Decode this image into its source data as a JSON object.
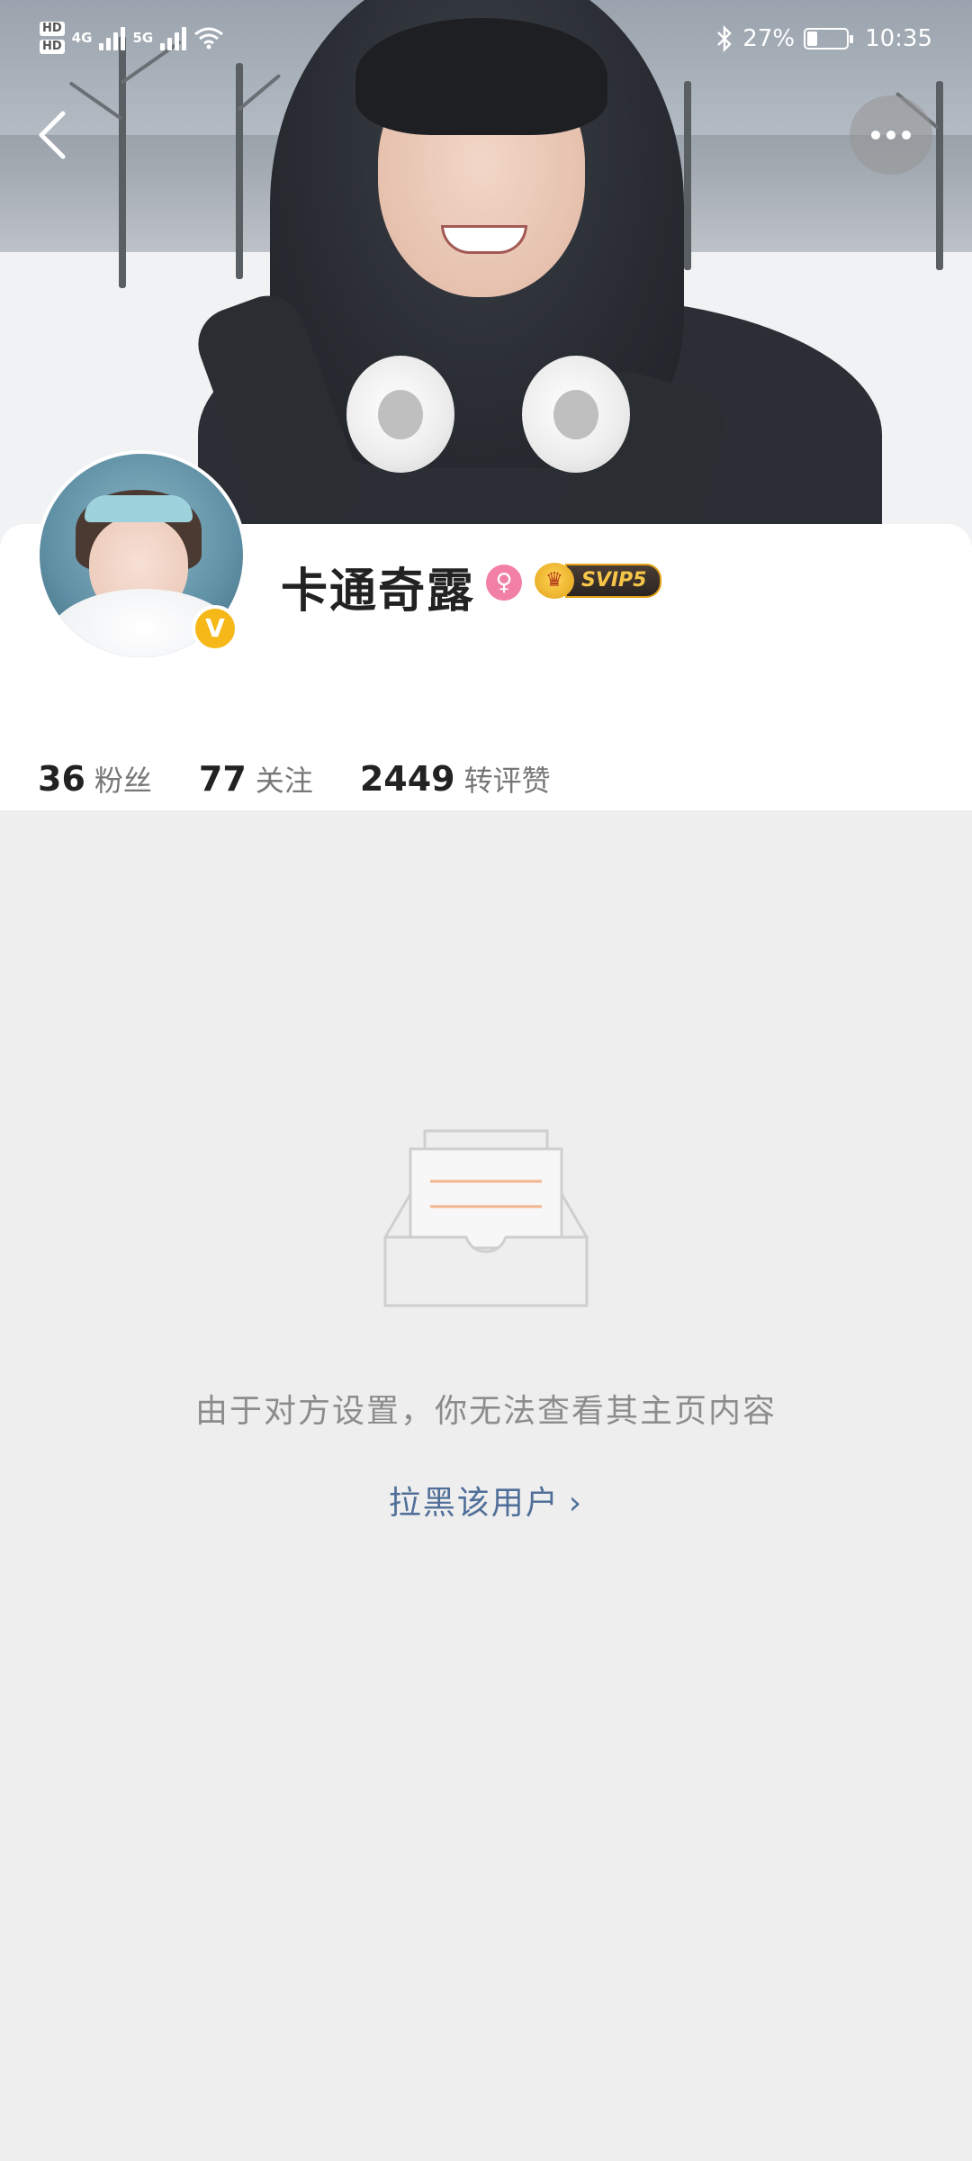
{
  "status_bar": {
    "hd1": "HD",
    "hd2": "HD",
    "net1": "4G",
    "net2": "5G",
    "battery_percent": "27%",
    "battery_level": 0.27,
    "time": "10:35"
  },
  "nav": {
    "back_icon": "chevron-left-icon",
    "more_icon": "more-horizontal-icon"
  },
  "profile": {
    "nickname": "卡通奇露",
    "gender": "female",
    "verified_badge": "V",
    "vip_label": "SVIP5",
    "stats": [
      {
        "value": "36",
        "label": "粉丝"
      },
      {
        "value": "77",
        "label": "关注"
      },
      {
        "value": "2449",
        "label": "转评赞"
      }
    ]
  },
  "empty_state": {
    "icon": "empty-inbox-icon",
    "message": "由于对方设置，你无法查看其主页内容",
    "block_link": "拉黑该用户",
    "block_chevron": "›"
  },
  "colors": {
    "accent_link": "#4f6f99",
    "vip_gold": "#f6b818",
    "gender_pink": "#f27fa5"
  }
}
